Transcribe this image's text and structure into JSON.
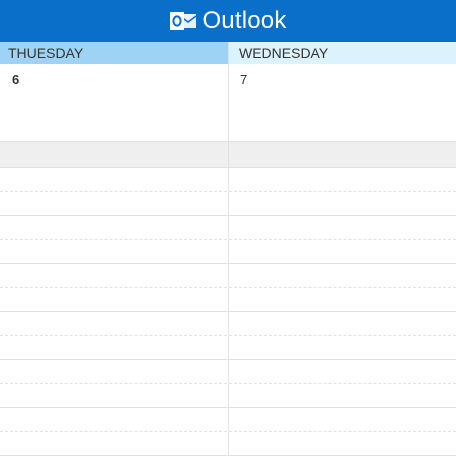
{
  "app": {
    "title": "Outlook",
    "brand_color": "#0a6fc8",
    "icon": "outlook-icon"
  },
  "days": [
    {
      "name": "THUESDAY",
      "date": "6",
      "header_color": "#9fd3f5"
    },
    {
      "name": "WEDNESDAY",
      "date": "7",
      "header_color": "#dcf2fc"
    }
  ]
}
